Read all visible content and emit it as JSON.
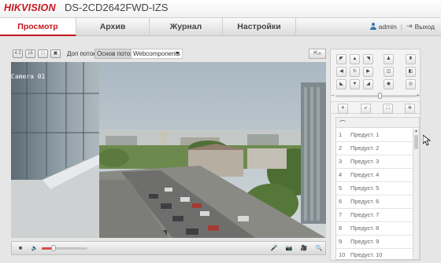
{
  "header": {
    "logo": "HIKVISION",
    "model": "DS-2CD2642FWD-IZS"
  },
  "nav": {
    "tabs": [
      {
        "label": "Просмотр",
        "active": true
      },
      {
        "label": "Архив",
        "active": false
      },
      {
        "label": "Журнал",
        "active": false
      },
      {
        "label": "Настройки",
        "active": false
      }
    ],
    "user": "admin",
    "separator": "|",
    "logout": "Выход"
  },
  "toolbar": {
    "stream_secondary": "Доп поток",
    "stream_main": "Основ поток",
    "plugin": "Webcomponents"
  },
  "video": {
    "osd_label": "Camera 01",
    "description_colors": {
      "sky": "#b9c3c8",
      "building": "#7f8a8f"
    }
  },
  "bottom": {
    "volume_level": 0.25
  },
  "ptz": {
    "speed_level": 0.55,
    "presets": [
      {
        "num": "1",
        "name": "Предуст. 1"
      },
      {
        "num": "2",
        "name": "Предуст. 2"
      },
      {
        "num": "3",
        "name": "Предуст. 3"
      },
      {
        "num": "4",
        "name": "Предуст. 4"
      },
      {
        "num": "5",
        "name": "Предуст. 5"
      },
      {
        "num": "6",
        "name": "Предуст. 6"
      },
      {
        "num": "7",
        "name": "Предуст. 7"
      },
      {
        "num": "8",
        "name": "Предуст. 8"
      },
      {
        "num": "9",
        "name": "Предуст. 9"
      },
      {
        "num": "10",
        "name": "Предуст. 10"
      }
    ]
  },
  "colors": {
    "accent": "#c8161d",
    "link": "#3a74b8"
  }
}
